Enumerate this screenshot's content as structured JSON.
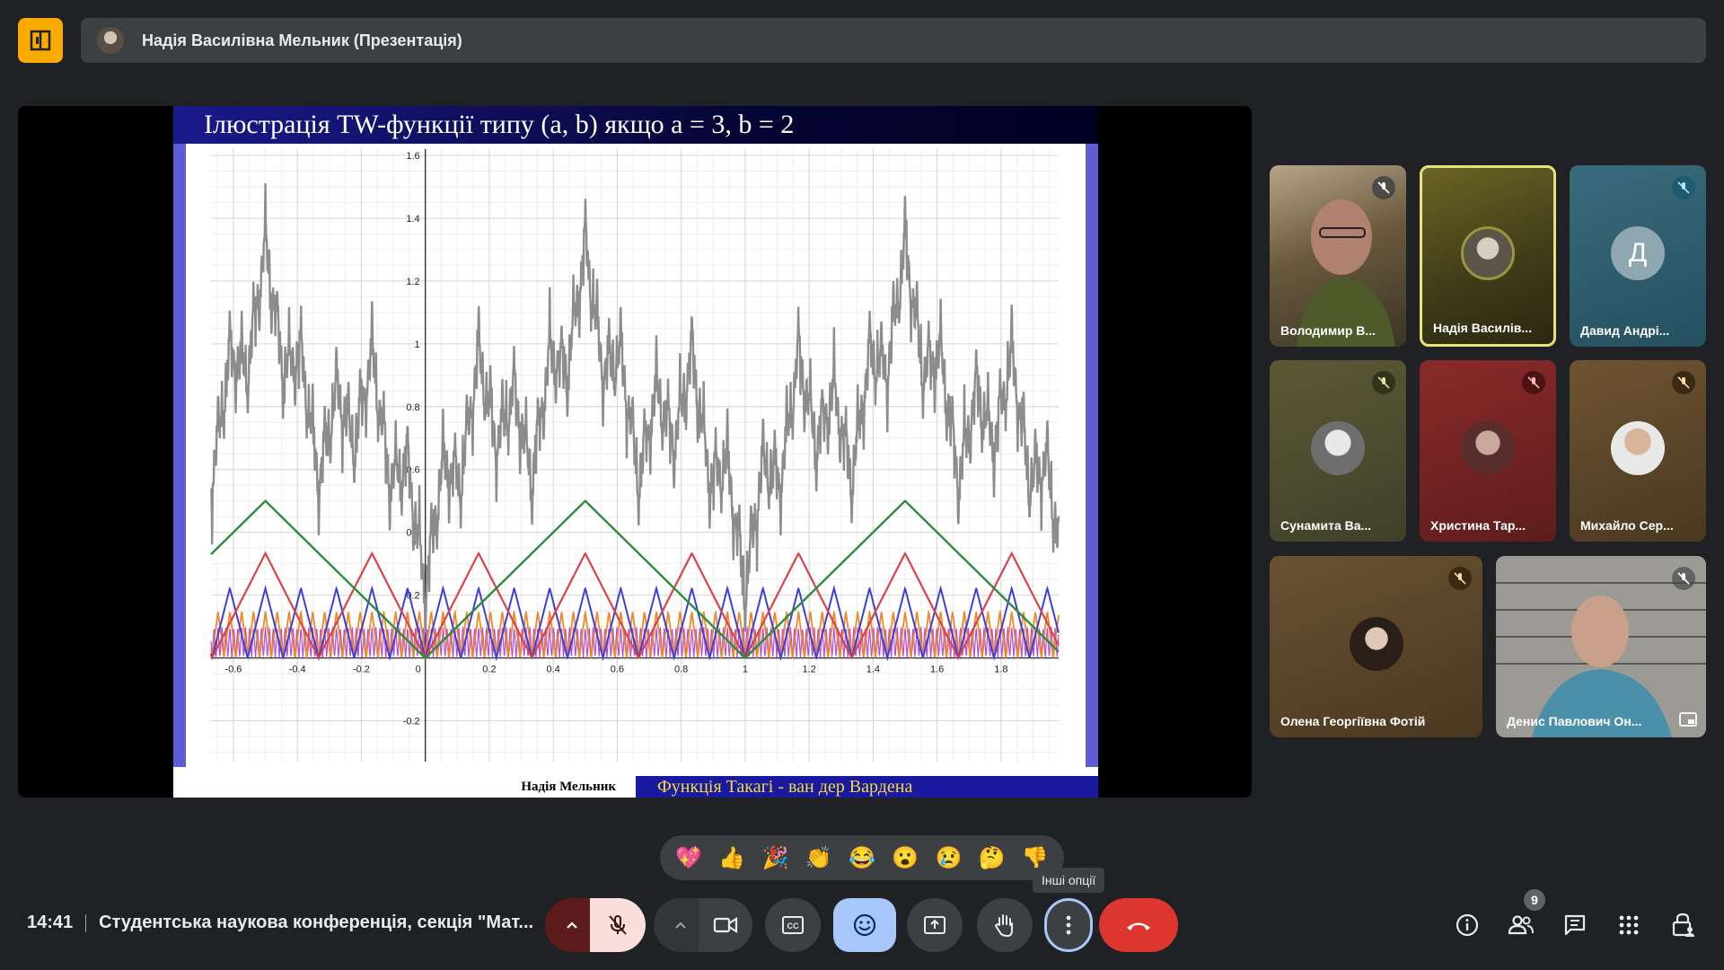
{
  "presenter": {
    "title": "Надія Василівна Мельник (Презентація)"
  },
  "slide": {
    "title": "Ілюстрація TW-функції типу (a, b) якщо a = 3, b = 2",
    "footer_left": "Надія Мельник",
    "footer_right": "Функція Такагі - ван дер Вардена",
    "ytick_labels": [
      "1.6",
      "1.4",
      "1.2",
      "1",
      "0.8",
      "0.6",
      "0.4",
      "0.2",
      "-0.2"
    ],
    "xtick_labels": [
      "-0.6",
      "-0.4",
      "-0.2",
      "0",
      "0.2",
      "0.4",
      "0.6",
      "0.8",
      "1",
      "1.2",
      "1.4",
      "1.6",
      "1.8"
    ],
    "colors": {
      "sum": "#8c8c8c",
      "g0": "#2e8b3e",
      "g1": "#d9434a",
      "g2": "#3f3fd6",
      "g3": "#f08a28",
      "g4": "#b24dd8"
    }
  },
  "chart_data": {
    "type": "line",
    "title": "Ілюстрація TW-функції типу (a, b) якщо a = 3, b = 2",
    "xlim": [
      -0.67,
      1.98
    ],
    "ylim": [
      -0.33,
      1.62
    ],
    "xticks": [
      -0.6,
      -0.4,
      -0.2,
      0,
      0.2,
      0.4,
      0.6,
      0.8,
      1,
      1.2,
      1.4,
      1.6,
      1.8
    ],
    "yticks": [
      -0.2,
      0.2,
      0.4,
      0.6,
      0.8,
      1,
      1.2,
      1.4,
      1.6
    ],
    "grid": true,
    "series": [
      {
        "color": "#2e8b3e",
        "x": [
          -0.667,
          -0.5,
          0,
          0.5,
          1,
          1.5,
          1.98
        ],
        "values": [
          0.333,
          0.5,
          0,
          0.5,
          0,
          0.5,
          0.02
        ]
      },
      {
        "color": "#d9434a",
        "x": [
          -0.5,
          -0.333,
          -0.167,
          0,
          0.167,
          0.333,
          0.5,
          0.667,
          0.833,
          1,
          1.167,
          1.333,
          1.5,
          1.667,
          1.833,
          1.98
        ],
        "values": [
          0,
          0.333,
          0,
          0.333,
          0,
          0.333,
          0,
          0.333,
          0,
          0.333,
          0,
          0.333,
          0,
          0.333,
          0,
          0.29
        ]
      },
      {
        "color": "#3f3fd6",
        "period": 0.111,
        "amplitude": 0.222
      },
      {
        "color": "#f08a28",
        "period": 0.037,
        "amplitude": 0.148
      },
      {
        "color": "#b24dd8",
        "period": 0.0123,
        "amplitude": 0.099
      },
      {
        "color": "#8c8c8c",
        "description_of_curve": "sum of components, peaks ≈1.3 at x = -0.5, 0.5, 1.5"
      }
    ]
  },
  "participants": [
    {
      "name": "Володимир В...",
      "muted": true
    },
    {
      "name": "Надія Василів...",
      "muted": false,
      "active": true
    },
    {
      "name": "Давид Андрі...",
      "muted": true,
      "initial": "Д"
    },
    {
      "name": "Сунамита Ва...",
      "muted": true
    },
    {
      "name": "Христина Тар...",
      "muted": true
    },
    {
      "name": "Михайло Сер...",
      "muted": true
    },
    {
      "name": "Олена Георгіївна Фотій",
      "muted": true
    },
    {
      "name": "Денис Павлович Он...",
      "muted": true
    }
  ],
  "reactions": [
    "💖",
    "👍",
    "🎉",
    "👏",
    "😂",
    "😮",
    "😢",
    "🤔",
    "👎"
  ],
  "tooltip": "Інші опції",
  "meeting": {
    "time": "14:41",
    "name": "Студентська наукова конференція, секція \"Мат..."
  },
  "people_count": "9"
}
